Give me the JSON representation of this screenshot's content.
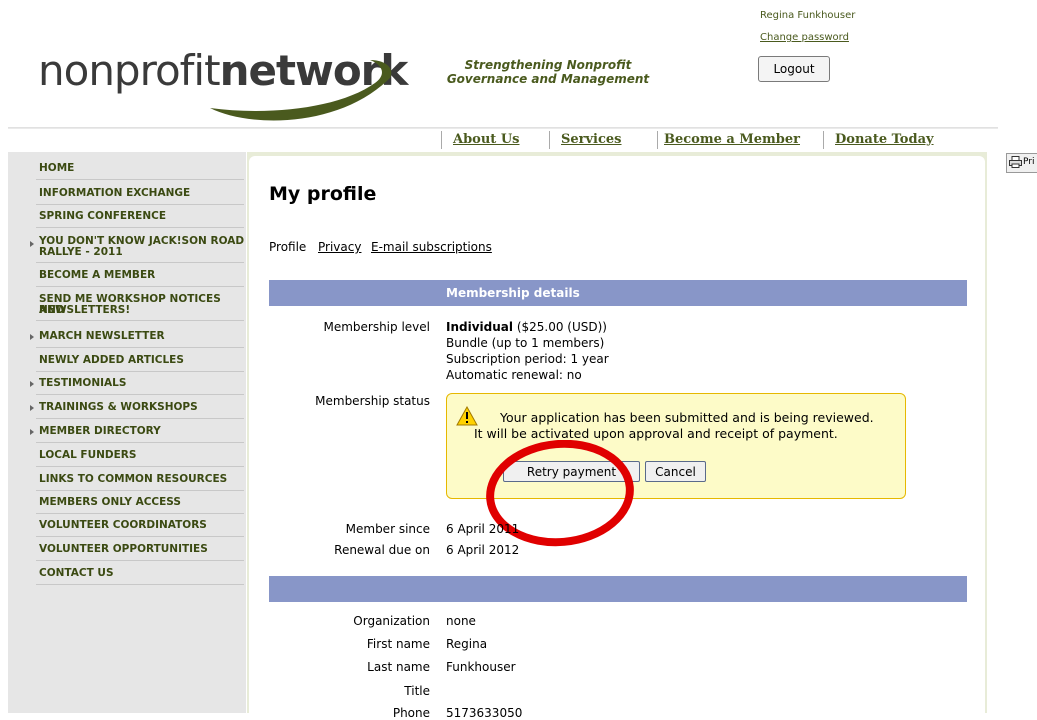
{
  "header": {
    "logo_light": "nonprofit",
    "logo_bold": "network",
    "tagline_line1": "Strengthening Nonprofit",
    "tagline_line2": "Governance and Management",
    "user_name": "Regina Funkhouser",
    "change_password": "Change password",
    "logout": "Logout"
  },
  "nav": [
    "About Us",
    "Services",
    "Become a Member",
    "Donate Today"
  ],
  "print_label": "Pri",
  "sidebar": [
    {
      "label": "HOME",
      "arrow": false
    },
    {
      "label": "INFORMATION EXCHANGE",
      "arrow": false
    },
    {
      "label": "SPRING CONFERENCE",
      "arrow": false
    },
    {
      "label": "YOU DON'T KNOW JACK!SON ROAD",
      "label2": "RALLYE - 2011",
      "arrow": true
    },
    {
      "label": "BECOME A MEMBER",
      "arrow": false
    },
    {
      "label": "SEND ME WORKSHOP NOTICES AND",
      "label2": "NEWSLETTERS!",
      "arrow": false
    },
    {
      "label": "MARCH NEWSLETTER",
      "arrow": true
    },
    {
      "label": "NEWLY ADDED ARTICLES",
      "arrow": false
    },
    {
      "label": "TESTIMONIALS",
      "arrow": true
    },
    {
      "label": "TRAININGS & WORKSHOPS",
      "arrow": true
    },
    {
      "label": "MEMBER DIRECTORY",
      "arrow": true
    },
    {
      "label": "LOCAL FUNDERS",
      "arrow": false
    },
    {
      "label": "LINKS TO COMMON RESOURCES",
      "arrow": false
    },
    {
      "label": "MEMBERS ONLY ACCESS",
      "arrow": false
    },
    {
      "label": "VOLUNTEER COORDINATORS",
      "arrow": false
    },
    {
      "label": "VOLUNTEER OPPORTUNITIES",
      "arrow": false
    },
    {
      "label": "CONTACT US",
      "arrow": false
    }
  ],
  "main": {
    "title": "My profile",
    "tabs": {
      "profile": "Profile",
      "privacy": "Privacy",
      "email": "E-mail subscriptions"
    },
    "membership_header": "Membership details",
    "membership_level_label": "Membership level",
    "level_name": "Individual",
    "level_price": " ($25.00 (USD))",
    "bundle": "Bundle (up to 1 members)",
    "subscription_period": "Subscription period: 1 year",
    "automatic_renewal": "Automatic renewal: no",
    "membership_status_label": "Membership status",
    "status_message": "Your application has been submitted and is being reviewed. It will be activated upon approval and receipt of payment.",
    "retry_payment": "Retry payment",
    "cancel": "Cancel",
    "member_since_label": "Member since",
    "member_since": "6 April 2011",
    "renewal_due_label": "Renewal due on",
    "renewal_due": "6 April 2012",
    "organization_label": "Organization",
    "organization": "none",
    "first_name_label": "First name",
    "first_name": "Regina",
    "last_name_label": "Last name",
    "last_name": "Funkhouser",
    "title_label": "Title",
    "phone_label": "Phone",
    "phone": "5173633050"
  },
  "colors": {
    "accent_green": "#4a5a1e",
    "section_bar": "#8896c8",
    "annotation_circle": "#e00000",
    "status_bg": "#fdfbc8"
  }
}
